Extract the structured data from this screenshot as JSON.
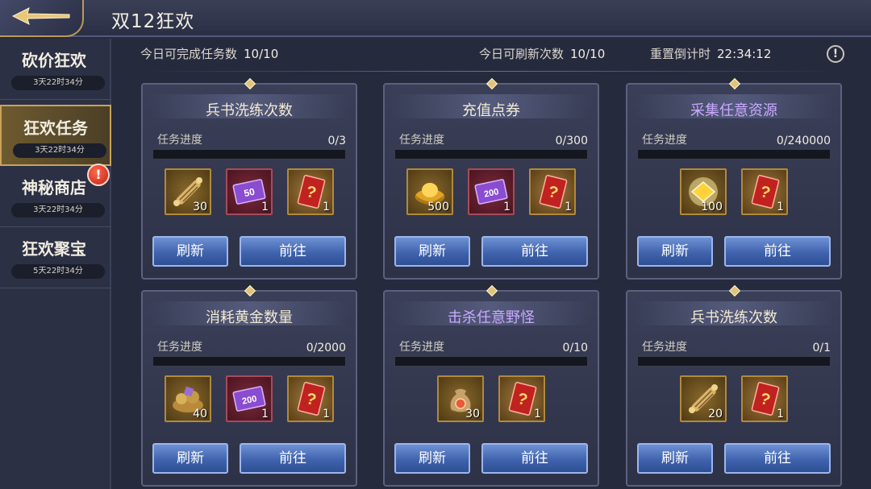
{
  "header": {
    "title": "双12狂欢"
  },
  "sidebar": {
    "items": [
      {
        "label": "砍价狂欢",
        "timer": "3天22时34分",
        "active": false,
        "alert": false
      },
      {
        "label": "狂欢任务",
        "timer": "3天22时34分",
        "active": true,
        "alert": false
      },
      {
        "label": "神秘商店",
        "timer": "3天22时34分",
        "active": false,
        "alert": true
      },
      {
        "label": "狂欢聚宝",
        "timer": "5天22时34分",
        "active": false,
        "alert": false
      }
    ],
    "alert_mark": "!"
  },
  "stats": {
    "tasks_label": "今日可完成任务数",
    "tasks_value": "10/10",
    "refresh_label": "今日可刷新次数",
    "refresh_value": "10/10",
    "countdown_label": "重置倒计时",
    "countdown_value": "22:34:12",
    "info_mark": "!"
  },
  "cards": [
    {
      "title": "兵书洗练次数",
      "title_color": "gold",
      "progress_label": "任务进度",
      "progress": "0/3",
      "progress_fraction": 0,
      "rewards": [
        {
          "icon": "scroll-icon",
          "count": "30",
          "frame": "gold"
        },
        {
          "icon": "coupon-50-icon",
          "count": "1",
          "frame": "purple"
        },
        {
          "icon": "mystery-card-icon",
          "count": "1",
          "frame": "red"
        }
      ],
      "refresh_label": "刷新",
      "go_label": "前往"
    },
    {
      "title": "充值点券",
      "title_color": "gold",
      "progress_label": "任务进度",
      "progress": "0/300",
      "progress_fraction": 0,
      "rewards": [
        {
          "icon": "gold-ingot-icon",
          "count": "500",
          "frame": "gold"
        },
        {
          "icon": "coupon-200-icon",
          "count": "1",
          "frame": "purple"
        },
        {
          "icon": "mystery-card-icon",
          "count": "1",
          "frame": "red"
        }
      ],
      "refresh_label": "刷新",
      "go_label": "前往"
    },
    {
      "title": "采集任意资源",
      "title_color": "purple",
      "progress_label": "任务进度",
      "progress": "0/240000",
      "progress_fraction": 0,
      "rewards": [
        {
          "icon": "glowing-gem-icon",
          "count": "100",
          "frame": "gold"
        },
        {
          "icon": "mystery-card-icon",
          "count": "1",
          "frame": "red"
        }
      ],
      "refresh_label": "刷新",
      "go_label": "前往"
    },
    {
      "title": "消耗黄金数量",
      "title_color": "gold",
      "progress_label": "任务进度",
      "progress": "0/2000",
      "progress_fraction": 0,
      "rewards": [
        {
          "icon": "treasure-pile-icon",
          "count": "40",
          "frame": "gold"
        },
        {
          "icon": "coupon-200-icon",
          "count": "1",
          "frame": "purple"
        },
        {
          "icon": "mystery-card-icon",
          "count": "1",
          "frame": "red"
        }
      ],
      "refresh_label": "刷新",
      "go_label": "前往"
    },
    {
      "title": "击杀任意野怪",
      "title_color": "purple",
      "progress_label": "任务进度",
      "progress": "0/10",
      "progress_fraction": 0,
      "rewards": [
        {
          "icon": "coin-pouch-icon",
          "count": "30",
          "frame": "gold"
        },
        {
          "icon": "mystery-card-icon",
          "count": "1",
          "frame": "red"
        }
      ],
      "refresh_label": "刷新",
      "go_label": "前往"
    },
    {
      "title": "兵书洗练次数",
      "title_color": "gold",
      "progress_label": "任务进度",
      "progress": "0/1",
      "progress_fraction": 0,
      "rewards": [
        {
          "icon": "scroll-icon",
          "count": "20",
          "frame": "gold"
        },
        {
          "icon": "mystery-card-icon",
          "count": "1",
          "frame": "red"
        }
      ],
      "refresh_label": "刷新",
      "go_label": "前往"
    }
  ],
  "coupon_text": {
    "c50": "50",
    "c200": "200"
  },
  "mystery_mark": "?"
}
